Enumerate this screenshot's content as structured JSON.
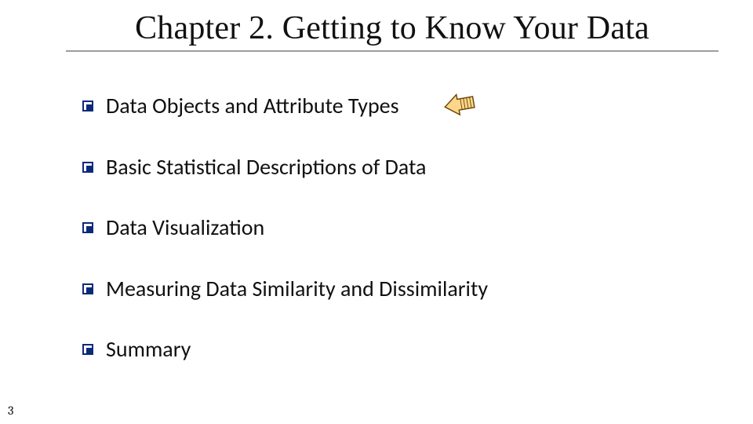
{
  "title": "Chapter 2.  Getting to Know Your Data",
  "bullets": [
    {
      "text": "Data Objects and Attribute Types"
    },
    {
      "text": "Basic Statistical Descriptions of Data"
    },
    {
      "text": "Data Visualization"
    },
    {
      "text": "Measuring Data Similarity and Dissimilarity"
    },
    {
      "text": "Summary"
    }
  ],
  "page_number": "3",
  "icons": {
    "pointer": "left-block-arrow-icon"
  },
  "colors": {
    "bullet_border": "#0a2a7a",
    "title_rule": "#9d9d9d",
    "arrow_fill": "#fbd78b",
    "arrow_stroke": "#6b3f00"
  }
}
